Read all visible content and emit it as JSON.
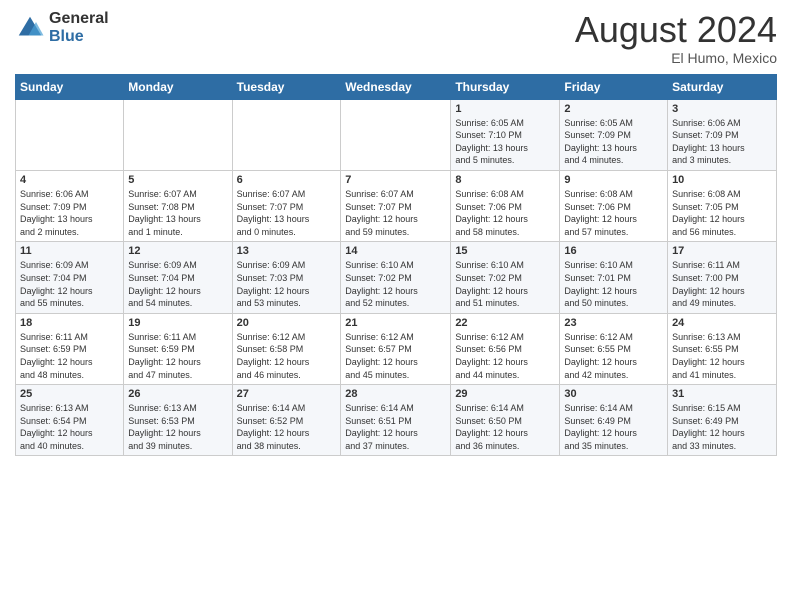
{
  "logo": {
    "general": "General",
    "blue": "Blue"
  },
  "title": "August 2024",
  "location": "El Humo, Mexico",
  "days_header": [
    "Sunday",
    "Monday",
    "Tuesday",
    "Wednesday",
    "Thursday",
    "Friday",
    "Saturday"
  ],
  "weeks": [
    [
      {
        "day": "",
        "info": ""
      },
      {
        "day": "",
        "info": ""
      },
      {
        "day": "",
        "info": ""
      },
      {
        "day": "",
        "info": ""
      },
      {
        "day": "1",
        "info": "Sunrise: 6:05 AM\nSunset: 7:10 PM\nDaylight: 13 hours\nand 5 minutes."
      },
      {
        "day": "2",
        "info": "Sunrise: 6:05 AM\nSunset: 7:09 PM\nDaylight: 13 hours\nand 4 minutes."
      },
      {
        "day": "3",
        "info": "Sunrise: 6:06 AM\nSunset: 7:09 PM\nDaylight: 13 hours\nand 3 minutes."
      }
    ],
    [
      {
        "day": "4",
        "info": "Sunrise: 6:06 AM\nSunset: 7:09 PM\nDaylight: 13 hours\nand 2 minutes."
      },
      {
        "day": "5",
        "info": "Sunrise: 6:07 AM\nSunset: 7:08 PM\nDaylight: 13 hours\nand 1 minute."
      },
      {
        "day": "6",
        "info": "Sunrise: 6:07 AM\nSunset: 7:07 PM\nDaylight: 13 hours\nand 0 minutes."
      },
      {
        "day": "7",
        "info": "Sunrise: 6:07 AM\nSunset: 7:07 PM\nDaylight: 12 hours\nand 59 minutes."
      },
      {
        "day": "8",
        "info": "Sunrise: 6:08 AM\nSunset: 7:06 PM\nDaylight: 12 hours\nand 58 minutes."
      },
      {
        "day": "9",
        "info": "Sunrise: 6:08 AM\nSunset: 7:06 PM\nDaylight: 12 hours\nand 57 minutes."
      },
      {
        "day": "10",
        "info": "Sunrise: 6:08 AM\nSunset: 7:05 PM\nDaylight: 12 hours\nand 56 minutes."
      }
    ],
    [
      {
        "day": "11",
        "info": "Sunrise: 6:09 AM\nSunset: 7:04 PM\nDaylight: 12 hours\nand 55 minutes."
      },
      {
        "day": "12",
        "info": "Sunrise: 6:09 AM\nSunset: 7:04 PM\nDaylight: 12 hours\nand 54 minutes."
      },
      {
        "day": "13",
        "info": "Sunrise: 6:09 AM\nSunset: 7:03 PM\nDaylight: 12 hours\nand 53 minutes."
      },
      {
        "day": "14",
        "info": "Sunrise: 6:10 AM\nSunset: 7:02 PM\nDaylight: 12 hours\nand 52 minutes."
      },
      {
        "day": "15",
        "info": "Sunrise: 6:10 AM\nSunset: 7:02 PM\nDaylight: 12 hours\nand 51 minutes."
      },
      {
        "day": "16",
        "info": "Sunrise: 6:10 AM\nSunset: 7:01 PM\nDaylight: 12 hours\nand 50 minutes."
      },
      {
        "day": "17",
        "info": "Sunrise: 6:11 AM\nSunset: 7:00 PM\nDaylight: 12 hours\nand 49 minutes."
      }
    ],
    [
      {
        "day": "18",
        "info": "Sunrise: 6:11 AM\nSunset: 6:59 PM\nDaylight: 12 hours\nand 48 minutes."
      },
      {
        "day": "19",
        "info": "Sunrise: 6:11 AM\nSunset: 6:59 PM\nDaylight: 12 hours\nand 47 minutes."
      },
      {
        "day": "20",
        "info": "Sunrise: 6:12 AM\nSunset: 6:58 PM\nDaylight: 12 hours\nand 46 minutes."
      },
      {
        "day": "21",
        "info": "Sunrise: 6:12 AM\nSunset: 6:57 PM\nDaylight: 12 hours\nand 45 minutes."
      },
      {
        "day": "22",
        "info": "Sunrise: 6:12 AM\nSunset: 6:56 PM\nDaylight: 12 hours\nand 44 minutes."
      },
      {
        "day": "23",
        "info": "Sunrise: 6:12 AM\nSunset: 6:55 PM\nDaylight: 12 hours\nand 42 minutes."
      },
      {
        "day": "24",
        "info": "Sunrise: 6:13 AM\nSunset: 6:55 PM\nDaylight: 12 hours\nand 41 minutes."
      }
    ],
    [
      {
        "day": "25",
        "info": "Sunrise: 6:13 AM\nSunset: 6:54 PM\nDaylight: 12 hours\nand 40 minutes."
      },
      {
        "day": "26",
        "info": "Sunrise: 6:13 AM\nSunset: 6:53 PM\nDaylight: 12 hours\nand 39 minutes."
      },
      {
        "day": "27",
        "info": "Sunrise: 6:14 AM\nSunset: 6:52 PM\nDaylight: 12 hours\nand 38 minutes."
      },
      {
        "day": "28",
        "info": "Sunrise: 6:14 AM\nSunset: 6:51 PM\nDaylight: 12 hours\nand 37 minutes."
      },
      {
        "day": "29",
        "info": "Sunrise: 6:14 AM\nSunset: 6:50 PM\nDaylight: 12 hours\nand 36 minutes."
      },
      {
        "day": "30",
        "info": "Sunrise: 6:14 AM\nSunset: 6:49 PM\nDaylight: 12 hours\nand 35 minutes."
      },
      {
        "day": "31",
        "info": "Sunrise: 6:15 AM\nSunset: 6:49 PM\nDaylight: 12 hours\nand 33 minutes."
      }
    ]
  ]
}
